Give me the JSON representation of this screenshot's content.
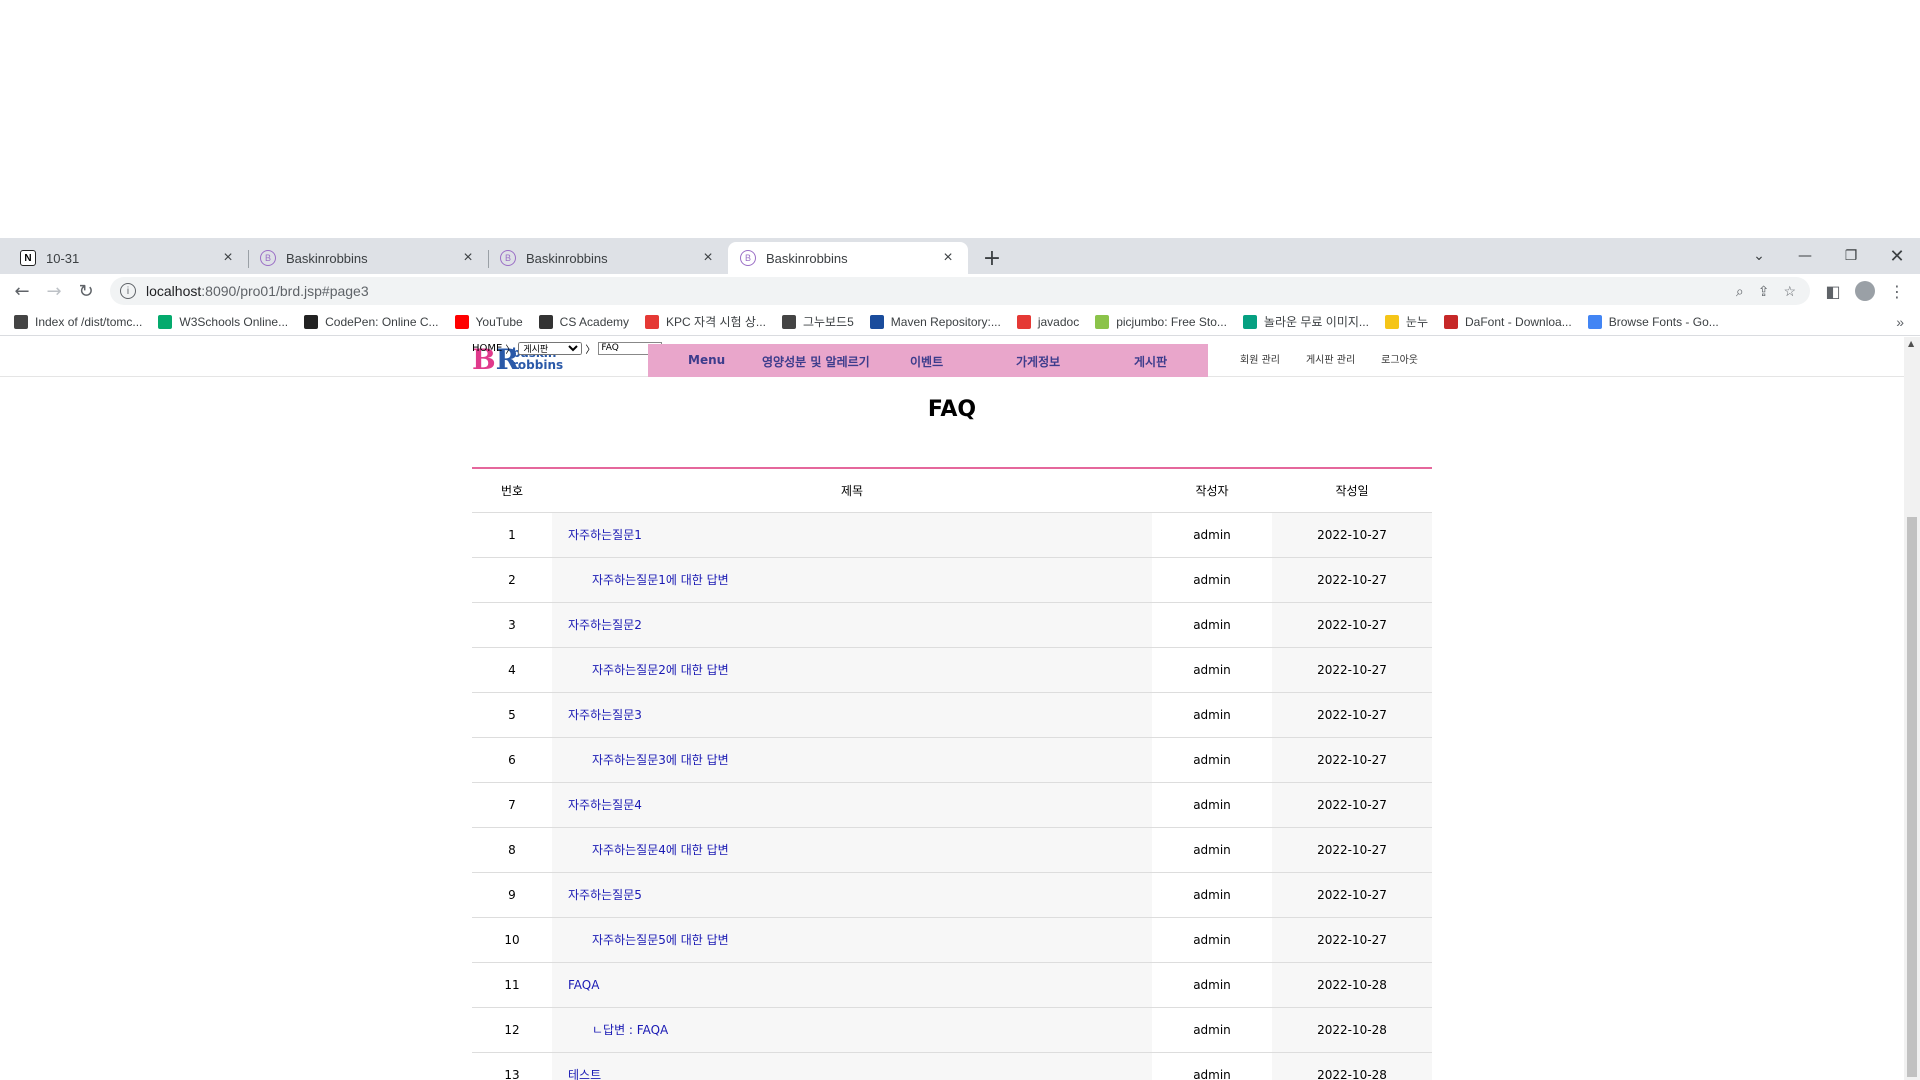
{
  "browser": {
    "tabs": [
      {
        "title": "10-31",
        "icon": "notion-icon"
      },
      {
        "title": "Baskinrobbins",
        "icon": "baskin-icon"
      },
      {
        "title": "Baskinrobbins",
        "icon": "baskin-icon"
      },
      {
        "title": "Baskinrobbins",
        "icon": "baskin-icon"
      }
    ],
    "url_host": "localhost",
    "url_path": ":8090/pro01/brd.jsp#page3",
    "bookmarks": [
      {
        "label": "Index of /dist/tomc...",
        "color": "#444444",
        "icon": "globe-icon"
      },
      {
        "label": "W3Schools Online...",
        "color": "#04aa6d",
        "icon": "w3schools-icon"
      },
      {
        "label": "CodePen: Online C...",
        "color": "#222222",
        "icon": "codepen-icon"
      },
      {
        "label": "YouTube",
        "color": "#ff0000",
        "icon": "youtube-icon"
      },
      {
        "label": "CS Academy",
        "color": "#333333",
        "icon": "cs-academy-icon"
      },
      {
        "label": "KPC 자격 시험 상...",
        "color": "#e53935",
        "icon": "kpc-icon"
      },
      {
        "label": "그누보드5",
        "color": "#444444",
        "icon": "globe-icon"
      },
      {
        "label": "Maven Repository:...",
        "color": "#1a4c9c",
        "icon": "maven-icon"
      },
      {
        "label": "javadoc",
        "color": "#e53935",
        "icon": "javadoc-icon"
      },
      {
        "label": "picjumbo: Free Sto...",
        "color": "#8bc34a",
        "icon": "picjumbo-icon"
      },
      {
        "label": "놀라운 무료 이미지...",
        "color": "#05a081",
        "icon": "pixabay-icon"
      },
      {
        "label": "눈누",
        "color": "#f5c518",
        "icon": "noonnu-icon"
      },
      {
        "label": "DaFont - Downloa...",
        "color": "#c62828",
        "icon": "dafont-icon"
      },
      {
        "label": "Browse Fonts - Go...",
        "color": "#4285f4",
        "icon": "google-fonts-icon"
      }
    ]
  },
  "site": {
    "breadcrumb_home": "HOME",
    "breadcrumb_select": "게시판",
    "breadcrumb_current": "FAQ",
    "logo_text_1": "baskin",
    "logo_text_2": "robbins",
    "nav": [
      "Menu",
      "영양성분 및 알레르기",
      "이벤트",
      "가게정보",
      "게시판"
    ],
    "subnav": [
      "회원 관리",
      "게시판 관리",
      "로그아웃"
    ],
    "page_title": "FAQ"
  },
  "table": {
    "headers": [
      "번호",
      "제목",
      "작성자",
      "작성일"
    ],
    "rows": [
      {
        "num": "1",
        "title": "자주하는질문1",
        "reply": false,
        "writer": "admin",
        "date": "2022-10-27"
      },
      {
        "num": "2",
        "title": "자주하는질문1에 대한 답변",
        "reply": true,
        "writer": "admin",
        "date": "2022-10-27"
      },
      {
        "num": "3",
        "title": "자주하는질문2",
        "reply": false,
        "writer": "admin",
        "date": "2022-10-27"
      },
      {
        "num": "4",
        "title": "자주하는질문2에 대한 답변",
        "reply": true,
        "writer": "admin",
        "date": "2022-10-27"
      },
      {
        "num": "5",
        "title": "자주하는질문3",
        "reply": false,
        "writer": "admin",
        "date": "2022-10-27"
      },
      {
        "num": "6",
        "title": "자주하는질문3에 대한 답변",
        "reply": true,
        "writer": "admin",
        "date": "2022-10-27"
      },
      {
        "num": "7",
        "title": "자주하는질문4",
        "reply": false,
        "writer": "admin",
        "date": "2022-10-27"
      },
      {
        "num": "8",
        "title": "자주하는질문4에 대한 답변",
        "reply": true,
        "writer": "admin",
        "date": "2022-10-27"
      },
      {
        "num": "9",
        "title": "자주하는질문5",
        "reply": false,
        "writer": "admin",
        "date": "2022-10-27"
      },
      {
        "num": "10",
        "title": "자주하는질문5에 대한 답변",
        "reply": true,
        "writer": "admin",
        "date": "2022-10-27"
      },
      {
        "num": "11",
        "title": "FAQA",
        "reply": false,
        "writer": "admin",
        "date": "2022-10-28"
      },
      {
        "num": "12",
        "title": "ㄴ답변 : FAQA",
        "reply": true,
        "writer": "admin",
        "date": "2022-10-28"
      },
      {
        "num": "13",
        "title": "테스트",
        "reply": false,
        "writer": "admin",
        "date": "2022-10-28"
      }
    ]
  },
  "colors": {
    "accent_pink": "#e9a6cb",
    "table_border": "#e5679c",
    "link_blue": "#1a1ab4"
  }
}
